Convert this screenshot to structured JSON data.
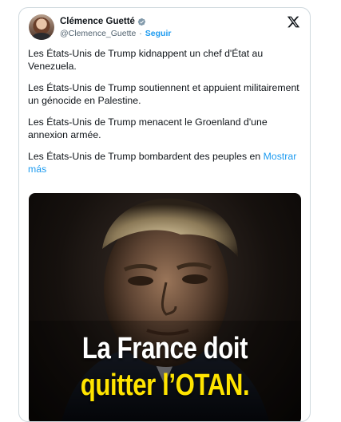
{
  "tweet": {
    "author_name": "Clémence Guetté",
    "handle": "@Clemence_Guette",
    "separator": "·",
    "follow_label": "Seguir",
    "paragraphs": [
      "Les États-Unis de Trump kidnappent un chef d'État au Venezuela.",
      "Les États-Unis de Trump soutiennent et appuient militairement un génocide en Palestine.",
      "Les États-Unis de Trump menacent le Groenland d'une annexion armée.",
      "Les États-Unis de Trump bombardent des peuples en"
    ],
    "show_more_label": "Mostrar más",
    "image_headline_line1": "La France doit",
    "image_headline_line2": "quitter l’OTAN."
  },
  "colors": {
    "link": "#1d9bf0",
    "verified_badge": "#829aab",
    "headline_yellow": "#ffe400",
    "border": "#cfd9de"
  },
  "icons": {
    "platform_logo": "x-logo-icon",
    "verified": "verified-badge-icon"
  }
}
